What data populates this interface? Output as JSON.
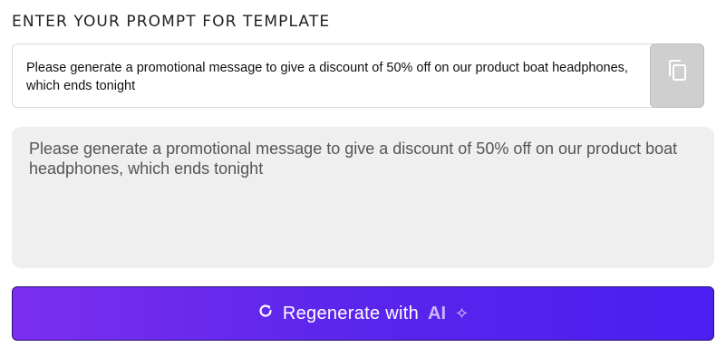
{
  "heading": "ENTER YOUR PROMPT FOR TEMPLATE",
  "prompt": {
    "value": "Please generate a promotional message to give a discount of 50% off on our product boat headphones, which ends tonight"
  },
  "output": {
    "text": "Please generate a promotional message to give a discount of 50% off on our product boat headphones, which ends tonight"
  },
  "regenerate": {
    "label": "Regenerate with",
    "ai": "AI",
    "sparkle": "✧"
  },
  "icons": {
    "copy": "copy-icon",
    "refresh": "refresh-icon"
  },
  "colors": {
    "button_gradient_start": "#7b2ff0",
    "button_gradient_end": "#4a1ff0",
    "output_bg": "#efefef"
  }
}
